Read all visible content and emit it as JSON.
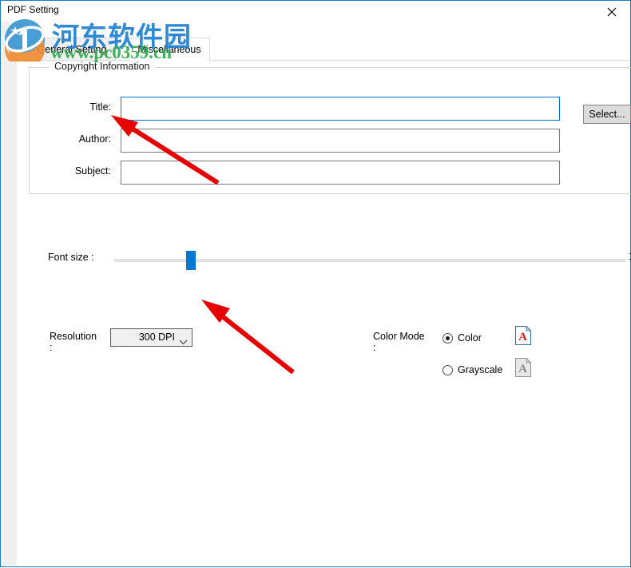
{
  "window": {
    "title": "PDF Setting",
    "close_icon": "close-icon"
  },
  "watermark": {
    "site_name": "河东软件园",
    "site_url": "www.pc0359.cn"
  },
  "tabs": [
    {
      "label": "General Setting",
      "active": false
    },
    {
      "label": "Miscellaneous",
      "active": true
    }
  ],
  "copyright_group": {
    "title": "Copyright Information",
    "fields": [
      {
        "label": "Title:",
        "value": "",
        "placeholder": "",
        "focused": true
      },
      {
        "label": "Author:",
        "value": "",
        "placeholder": "",
        "focused": false
      },
      {
        "label": "Subject:",
        "value": "",
        "placeholder": "",
        "focused": false
      }
    ],
    "select_button": "Select..."
  },
  "font_size": {
    "label": "Font size :",
    "max_label": "1",
    "value_percent": 14
  },
  "resolution": {
    "label": "Resolution\n:",
    "label_line1": "Resolution",
    "label_line2": ":",
    "selected": "300 DPI",
    "options": [
      "300 DPI"
    ]
  },
  "color_mode": {
    "label_line1": "Color Mode",
    "label_line2": ":",
    "options": [
      {
        "label": "Color",
        "selected": true,
        "icon": "document-red-a-icon"
      },
      {
        "label": "Grayscale",
        "selected": false,
        "icon": "document-gray-a-icon"
      }
    ]
  },
  "annotations": [
    {
      "name": "arrow-to-title-field"
    },
    {
      "name": "arrow-to-resolution"
    }
  ],
  "colors": {
    "accent": "#0078d7",
    "window_border": "#1a7bc4",
    "annotation_red": "#e60000",
    "watermark_blue": "#1f7fd0",
    "watermark_green": "#2eab4f"
  }
}
